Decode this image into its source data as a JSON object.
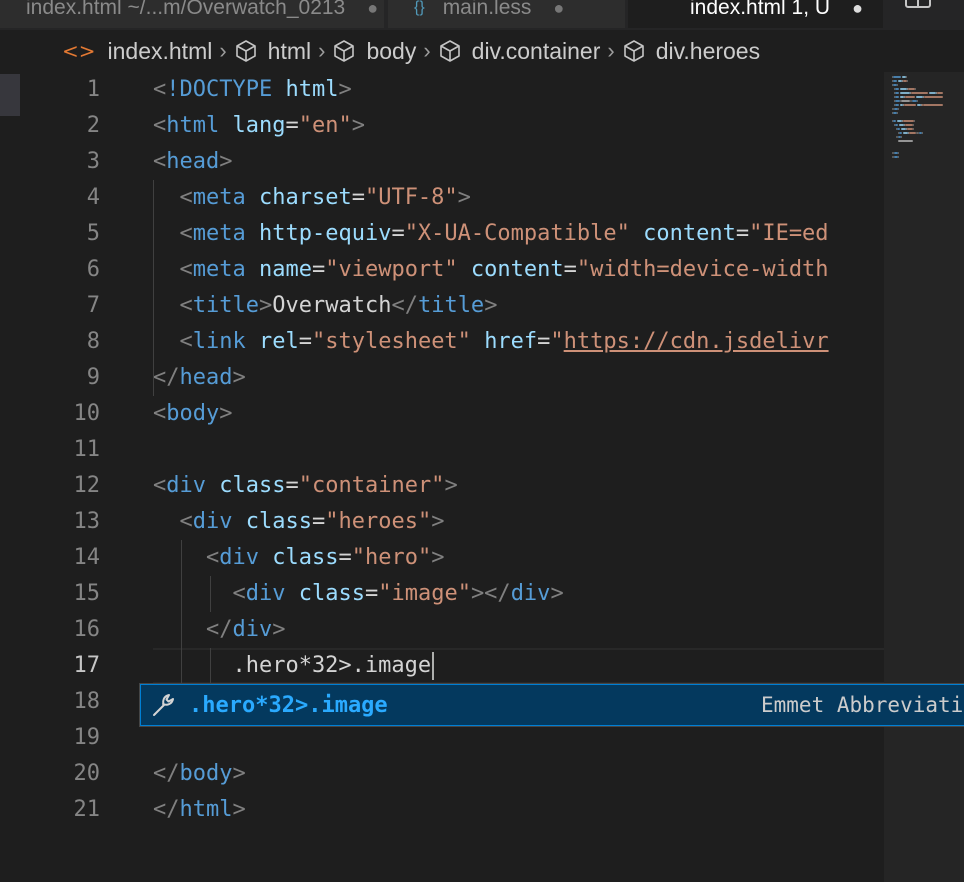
{
  "tabs": [
    {
      "label": "index.html ~/...m/Overwatch_0213",
      "close": "●"
    },
    {
      "label": "main.less",
      "close": "●"
    },
    {
      "label": "index.html 1, U",
      "close": "●"
    }
  ],
  "breadcrumb": {
    "file": "index.html",
    "items": [
      "html",
      "body",
      "div.container",
      "div.heroes"
    ]
  },
  "editor": {
    "lines": [
      {
        "n": "1",
        "tokens": [
          [
            "punc",
            "<"
          ],
          [
            "tag",
            "!DOCTYPE"
          ],
          [
            "text",
            " "
          ],
          [
            "attr",
            "html"
          ],
          [
            "punc",
            ">"
          ]
        ]
      },
      {
        "n": "2",
        "tokens": [
          [
            "punc",
            "<"
          ],
          [
            "tag",
            "html"
          ],
          [
            "text",
            " "
          ],
          [
            "attr",
            "lang"
          ],
          [
            "text",
            "="
          ],
          [
            "str",
            "\"en\""
          ],
          [
            "punc",
            ">"
          ]
        ]
      },
      {
        "n": "3",
        "tokens": [
          [
            "punc",
            "<"
          ],
          [
            "tag",
            "head"
          ],
          [
            "punc",
            ">"
          ]
        ]
      },
      {
        "n": "4",
        "tokens": [
          [
            "text",
            "  "
          ],
          [
            "punc",
            "<"
          ],
          [
            "tag",
            "meta"
          ],
          [
            "text",
            " "
          ],
          [
            "attr",
            "charset"
          ],
          [
            "text",
            "="
          ],
          [
            "str",
            "\"UTF-8\""
          ],
          [
            "punc",
            ">"
          ]
        ]
      },
      {
        "n": "5",
        "tokens": [
          [
            "text",
            "  "
          ],
          [
            "punc",
            "<"
          ],
          [
            "tag",
            "meta"
          ],
          [
            "text",
            " "
          ],
          [
            "attr",
            "http-equiv"
          ],
          [
            "text",
            "="
          ],
          [
            "str",
            "\"X-UA-Compatible\""
          ],
          [
            "text",
            " "
          ],
          [
            "attr",
            "content"
          ],
          [
            "text",
            "="
          ],
          [
            "str",
            "\"IE=ed"
          ]
        ]
      },
      {
        "n": "6",
        "tokens": [
          [
            "text",
            "  "
          ],
          [
            "punc",
            "<"
          ],
          [
            "tag",
            "meta"
          ],
          [
            "text",
            " "
          ],
          [
            "attr",
            "name"
          ],
          [
            "text",
            "="
          ],
          [
            "str",
            "\"viewport\""
          ],
          [
            "text",
            " "
          ],
          [
            "attr",
            "content"
          ],
          [
            "text",
            "="
          ],
          [
            "str",
            "\"width=device-width"
          ]
        ]
      },
      {
        "n": "7",
        "tokens": [
          [
            "text",
            "  "
          ],
          [
            "punc",
            "<"
          ],
          [
            "tag",
            "title"
          ],
          [
            "punc",
            ">"
          ],
          [
            "text",
            "Overwatch"
          ],
          [
            "punc",
            "</"
          ],
          [
            "tag",
            "title"
          ],
          [
            "punc",
            ">"
          ]
        ]
      },
      {
        "n": "8",
        "tokens": [
          [
            "text",
            "  "
          ],
          [
            "punc",
            "<"
          ],
          [
            "tag",
            "link"
          ],
          [
            "text",
            " "
          ],
          [
            "attr",
            "rel"
          ],
          [
            "text",
            "="
          ],
          [
            "str",
            "\"stylesheet\""
          ],
          [
            "text",
            " "
          ],
          [
            "attr",
            "href"
          ],
          [
            "text",
            "="
          ],
          [
            "str",
            "\""
          ],
          [
            "link",
            "https://cdn.jsdelivr"
          ]
        ]
      },
      {
        "n": "9",
        "tokens": [
          [
            "punc",
            "</"
          ],
          [
            "tag",
            "head"
          ],
          [
            "punc",
            ">"
          ]
        ]
      },
      {
        "n": "10",
        "tokens": [
          [
            "punc",
            "<"
          ],
          [
            "tag",
            "body"
          ],
          [
            "punc",
            ">"
          ]
        ]
      },
      {
        "n": "11",
        "tokens": []
      },
      {
        "n": "12",
        "tokens": [
          [
            "punc",
            "<"
          ],
          [
            "tag",
            "div"
          ],
          [
            "text",
            " "
          ],
          [
            "attr",
            "class"
          ],
          [
            "text",
            "="
          ],
          [
            "str",
            "\"container\""
          ],
          [
            "punc",
            ">"
          ]
        ]
      },
      {
        "n": "13",
        "tokens": [
          [
            "text",
            "  "
          ],
          [
            "punc",
            "<"
          ],
          [
            "tag",
            "div"
          ],
          [
            "text",
            " "
          ],
          [
            "attr",
            "class"
          ],
          [
            "text",
            "="
          ],
          [
            "str",
            "\"heroes\""
          ],
          [
            "punc",
            ">"
          ]
        ]
      },
      {
        "n": "14",
        "tokens": [
          [
            "text",
            "    "
          ],
          [
            "punc",
            "<"
          ],
          [
            "tag",
            "div"
          ],
          [
            "text",
            " "
          ],
          [
            "attr",
            "class"
          ],
          [
            "text",
            "="
          ],
          [
            "str",
            "\"hero\""
          ],
          [
            "punc",
            ">"
          ]
        ]
      },
      {
        "n": "15",
        "tokens": [
          [
            "text",
            "      "
          ],
          [
            "punc",
            "<"
          ],
          [
            "tag",
            "div"
          ],
          [
            "text",
            " "
          ],
          [
            "attr",
            "class"
          ],
          [
            "text",
            "="
          ],
          [
            "str",
            "\"image\""
          ],
          [
            "punc",
            "></"
          ],
          [
            "tag",
            "div"
          ],
          [
            "punc",
            ">"
          ]
        ]
      },
      {
        "n": "16",
        "tokens": [
          [
            "text",
            "    "
          ],
          [
            "punc",
            "</"
          ],
          [
            "tag",
            "div"
          ],
          [
            "punc",
            ">"
          ]
        ]
      },
      {
        "n": "17",
        "tokens": [
          [
            "text",
            "      .hero*32>.image"
          ]
        ],
        "active": true
      },
      {
        "n": "18",
        "tokens": []
      },
      {
        "n": "19",
        "tokens": []
      },
      {
        "n": "20",
        "tokens": [
          [
            "punc",
            "</"
          ],
          [
            "tag",
            "body"
          ],
          [
            "punc",
            ">"
          ]
        ]
      },
      {
        "n": "21",
        "tokens": [
          [
            "punc",
            "</"
          ],
          [
            "tag",
            "html"
          ],
          [
            "punc",
            ">"
          ]
        ]
      }
    ]
  },
  "suggest": {
    "label": ".hero*32>.image",
    "detail": "Emmet Abbreviation",
    "icon": "wrench-icon"
  },
  "colors": {
    "tag": "#569cd6",
    "attr": "#9cdcfe",
    "string": "#ce9178",
    "punctuation": "#808080",
    "accent": "#2aaaff"
  }
}
